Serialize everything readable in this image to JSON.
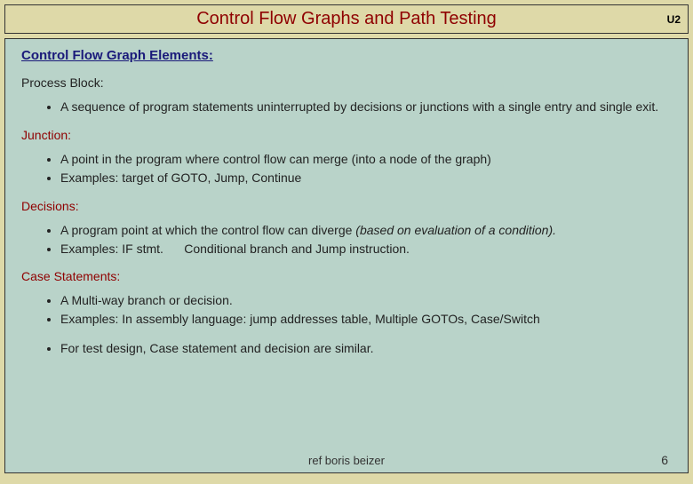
{
  "header": {
    "title": "Control Flow Graphs and Path Testing",
    "badge": "U2"
  },
  "sectionTitle": "Control Flow Graph Elements:",
  "sections": [
    {
      "heading": "Process Block:",
      "headingClass": "",
      "bullets": [
        "A sequence of program statements uninterrupted by decisions or junctions with a single entry and single exit."
      ]
    },
    {
      "heading": "Junction:",
      "headingClass": "red",
      "bullets": [
        "A point in the program where control flow can merge (into a node of the graph)",
        "Examples: target of GOTO, Jump, Continue"
      ]
    },
    {
      "heading": "Decisions:",
      "headingClass": "red",
      "bullets": [
        "A program point at which the control flow can diverge <span class=\"ital\">(based on evaluation of a condition).</span>",
        "Examples:  IF  stmt. &nbsp;&nbsp;&nbsp;&nbsp; Conditional branch and Jump instruction."
      ]
    },
    {
      "heading": "Case Statements:",
      "headingClass": "red",
      "bullets": [
        "A Multi-way branch or decision.",
        "Examples:  In assembly language: jump addresses table, Multiple GOTOs, Case/Switch"
      ],
      "extraBullets": [
        "For test design, Case statement and decision are similar."
      ]
    }
  ],
  "footer": {
    "ref": "ref boris beizer",
    "page": "6"
  }
}
